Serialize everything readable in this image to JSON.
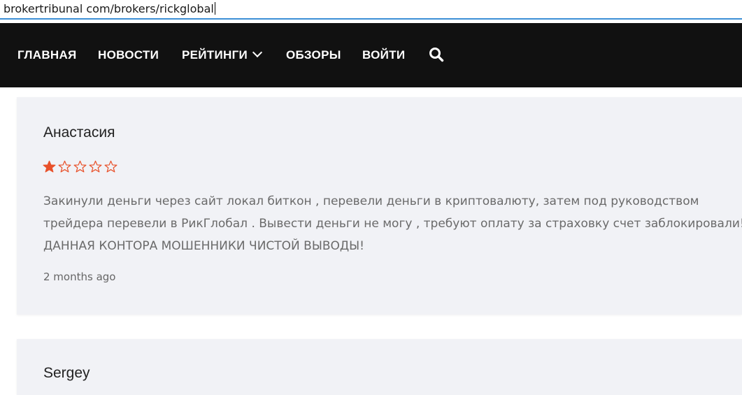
{
  "browser": {
    "url": "brokertribunal com/brokers/rickglobal"
  },
  "nav": {
    "items": [
      {
        "label": "ГЛАВНАЯ"
      },
      {
        "label": "НОВОСТИ"
      },
      {
        "label": "РЕЙТИНГИ"
      },
      {
        "label": "ОБЗОРЫ"
      },
      {
        "label": "ВОЙТИ"
      }
    ],
    "search_icon": "search-icon"
  },
  "reviews": [
    {
      "author": "Анастасия",
      "rating": 1,
      "rating_max": 5,
      "text_lines": [
        "Закинули деньги через сайт локал биткон , перевели деньги в криптовалюту, затем под руководством",
        "трейдера перевели в РикГлобал . Вывести деньги не могу , требуют оплату за страховку счет заблокировали!",
        "ДАННАЯ КОНТОРА МОШЕННИКИ ЧИСТОЙ ВЫВОДЫ!"
      ],
      "time": "2 months ago"
    },
    {
      "author": "Sergey"
    }
  ],
  "colors": {
    "nav_bg": "#111111",
    "card_bg": "#f1f2f6",
    "star": "#e8512a",
    "address_underline": "#3c8fd6"
  }
}
